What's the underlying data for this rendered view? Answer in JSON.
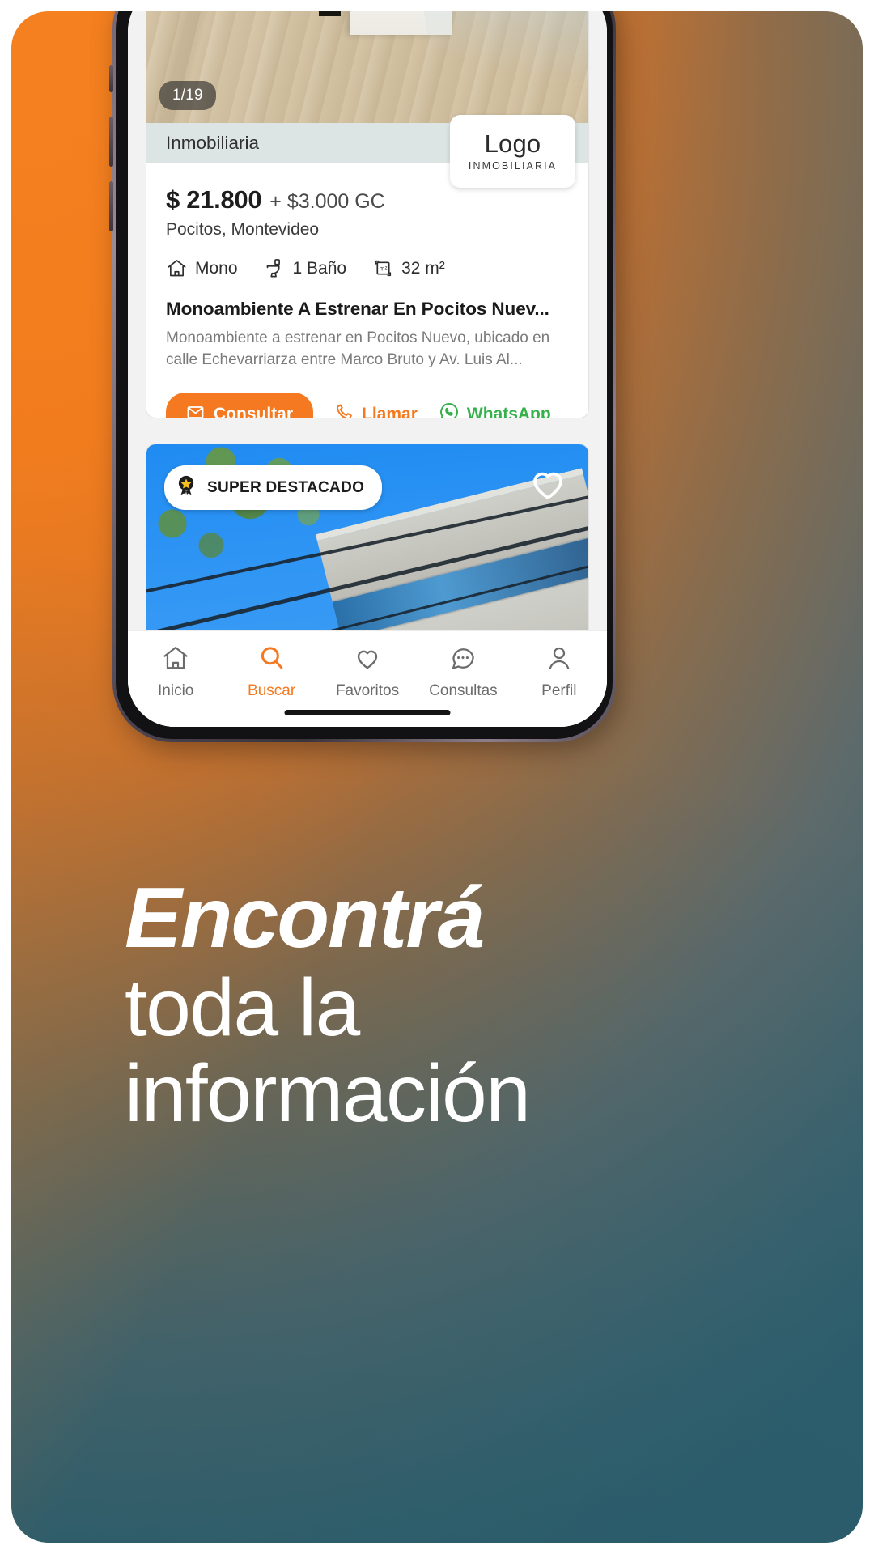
{
  "poster": {
    "background_gradient_from": "#f4801f",
    "background_gradient_to": "#33606e",
    "headline": {
      "line1": "Encontrá",
      "line2": "toda la",
      "line3": "información"
    }
  },
  "app": {
    "accent_color": "#f47920",
    "whatsapp_color": "#35b14b",
    "listing_primary": {
      "photo_counter": "1/19",
      "logo_badge": {
        "main": "Logo",
        "sub": "INMOBILIARIA"
      },
      "agency_label": "Inmobiliaria",
      "price": "$ 21.800",
      "price_extra": "+ $3.000 GC",
      "location": "Pocitos, Montevideo",
      "attributes": [
        {
          "icon": "house-icon",
          "label": "Mono"
        },
        {
          "icon": "toilet-icon",
          "label": "1 Baño"
        },
        {
          "icon": "area-icon",
          "label": "32 m²"
        }
      ],
      "title": "Monoambiente A Estrenar En Pocitos Nuev...",
      "description": "Monoambiente a estrenar en Pocitos Nuevo, ubicado en calle Echevarriarza entre Marco Bruto y Av. Luis Al...",
      "actions": {
        "consultar": "Consultar",
        "llamar": "Llamar",
        "whatsapp": "WhatsApp"
      }
    },
    "listing_secondary": {
      "badge": "SUPER DESTACADO",
      "badge_icon": "star-award-icon",
      "favorite_icon": "heart-outline-icon"
    },
    "bottom_nav": {
      "items": [
        {
          "icon": "home-icon",
          "label": "Inicio",
          "active": false
        },
        {
          "icon": "search-icon",
          "label": "Buscar",
          "active": true
        },
        {
          "icon": "heart-icon",
          "label": "Favoritos",
          "active": false
        },
        {
          "icon": "chat-dots-icon",
          "label": "Consultas",
          "active": false
        },
        {
          "icon": "person-icon",
          "label": "Perfil",
          "active": false
        }
      ]
    }
  }
}
